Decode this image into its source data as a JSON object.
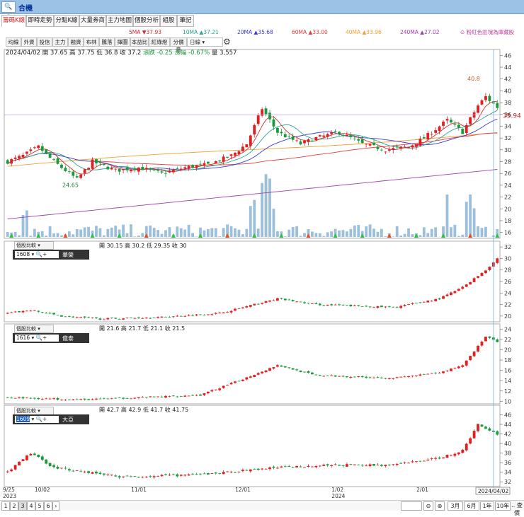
{
  "app": {
    "search_icon": "search-plus-icon",
    "title": "合機"
  },
  "tabs": [
    "籌碼K線",
    "即時走勢",
    "分點K線",
    "大量券商",
    "主力地圖",
    "個股分析",
    "組股",
    "筆記"
  ],
  "tools": [
    "均線",
    "外資",
    "投信",
    "主力",
    "融資",
    "布林",
    "騰落",
    "擇圖",
    "本益比",
    "紅綠燈",
    "分價量"
  ],
  "tools_select": "日線",
  "ma_legend": [
    {
      "label": "5MA ▼37.93",
      "color": "#d03030"
    },
    {
      "label": "10MA ▲37.21",
      "color": "#2aa58f"
    },
    {
      "label": "20MA ▲35.68",
      "color": "#3a3ad0"
    },
    {
      "label": "60MA ▲33.00",
      "color": "#e04040"
    },
    {
      "label": "40MA ▲33.96",
      "color": "#f0a030"
    },
    {
      "label": "240MA ▲27.02",
      "color": "#a040b0"
    }
  ],
  "ma_hint": "粉紅色區塊為庫藏股",
  "main_info": {
    "date": "2024/04/02",
    "open_label": "開",
    "open": "37.65",
    "high_label": "高",
    "high": "37.75",
    "low_label": "低",
    "low": "36.8",
    "close_label": "收",
    "close": "37.2",
    "change_label": "漲跌",
    "change": "-0.25",
    "pct_label": "漲幅",
    "pct": "-0.67%",
    "vol_label": "量",
    "vol": "3,557"
  },
  "chart_data": [
    {
      "type": "candlestick",
      "stock": "合機",
      "ylim": [
        15,
        47
      ],
      "yticks": [
        16,
        18,
        20,
        22,
        24,
        26,
        28,
        30,
        32,
        34,
        36,
        38,
        40,
        42,
        44,
        46
      ],
      "current_price": "35.94",
      "max_label": "40.8",
      "min_label": "24.65",
      "xlabels": [
        "9/25 2023",
        "10/02",
        "11/01",
        "12/01",
        "1/02 2024",
        "2/01",
        "3/01",
        "2024/04/02"
      ]
    },
    {
      "type": "candlestick",
      "stock_code": "1608",
      "stock_name": "華榮",
      "open": "30.15",
      "high": "30.2",
      "low": "29.35",
      "close": "30",
      "ylim": [
        19,
        33
      ],
      "yticks": [
        20,
        22,
        24,
        26,
        28,
        30,
        32
      ]
    },
    {
      "type": "candlestick",
      "stock_code": "1616",
      "stock_name": "億泰",
      "open": "21.6",
      "high": "21.7",
      "low": "21.1",
      "close": "21.5",
      "ylim": [
        9.5,
        25
      ],
      "yticks": [
        10,
        12,
        14,
        16,
        18,
        20,
        22,
        24
      ]
    },
    {
      "type": "candlestick",
      "stock_code": "1609",
      "stock_name": "大亞",
      "open": "42.7",
      "high": "42.9",
      "low": "41.7",
      "close": "41.75",
      "ylim": [
        31,
        48
      ],
      "yticks": [
        32,
        34,
        36,
        38,
        40,
        42,
        44,
        46
      ]
    }
  ],
  "sub_select_label": "個股比較",
  "ohlc_labels": [
    "開",
    "高",
    "低",
    "收"
  ],
  "footer": {
    "pages": [
      "1",
      "2",
      "3",
      "4",
      "5",
      "6"
    ],
    "ranges": [
      "3月",
      "6月",
      "1年",
      "10年"
    ],
    "more": "‥ 查價"
  }
}
